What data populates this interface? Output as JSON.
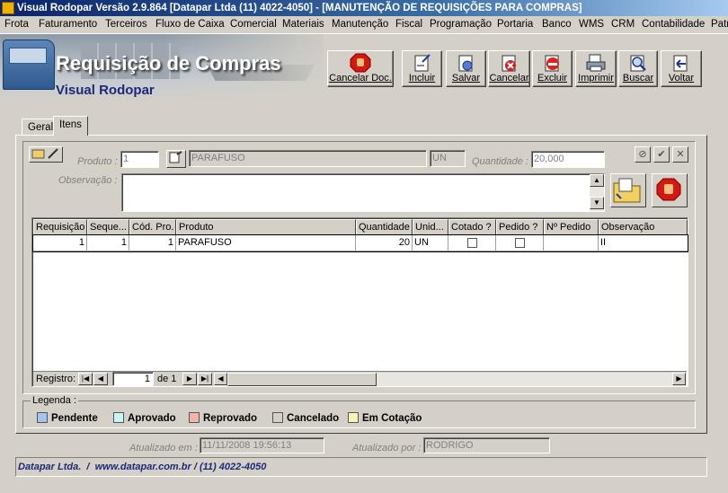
{
  "window": {
    "title": "Visual Rodopar Versão 2.9.864 [Datapar Ltda (11) 4022-4050]  - [MANUTENÇÃO DE REQUISIÇÕES PARA COMPRAS]"
  },
  "menu": [
    "Frota",
    "Faturamento",
    "Terceiros",
    "Fluxo de Caixa",
    "Comercial",
    "Materiais",
    "Manutenção",
    "Fiscal",
    "Programação",
    "Portaria",
    "Banco",
    "WMS",
    "CRM",
    "Contabilidade",
    "Patr"
  ],
  "banner": {
    "title": "Requisição de Compras",
    "subtitle": "Visual Rodopar"
  },
  "toolbar": {
    "cancel_doc": "Cancelar Doc.",
    "incluir": "Incluir",
    "salvar": "Salvar",
    "cancelar": "Cancelar",
    "excluir": "Excluir",
    "imprimir": "Imprimir",
    "buscar": "Buscar",
    "voltar": "Voltar"
  },
  "tabs": {
    "geral": "Geral",
    "itens": "Itens"
  },
  "form": {
    "produto_label": "Produto :",
    "produto_code": "1",
    "produto_name": "PARAFUSO",
    "unit": "UN",
    "quantidade_label": "Quantidade :",
    "quantidade": "20,000",
    "observacao_label": "Observação :",
    "observacao": ""
  },
  "grid": {
    "headers": [
      "Requisição",
      "Seque...",
      "Cód. Pro.",
      "Produto",
      "Quantidade",
      "Unid...",
      "Cotado ?",
      "Pedido ?",
      "Nº Pedido",
      "Observação"
    ],
    "rows": [
      {
        "requisicao": "1",
        "sequencia": "1",
        "cod": "1",
        "produto": "PARAFUSO",
        "quantidade": "20",
        "unid": "UN",
        "cotado": false,
        "pedido": false,
        "num_pedido": "",
        "observacao": "II"
      }
    ]
  },
  "navigator": {
    "label": "Registro:",
    "current": "1",
    "of": "de 1"
  },
  "legend": {
    "title": "Legenda :",
    "items": [
      {
        "label": "Pendente",
        "color": "#a7c4f0"
      },
      {
        "label": "Aprovado",
        "color": "#c8f4f8"
      },
      {
        "label": "Reprovado",
        "color": "#f4b4a8"
      },
      {
        "label": "Cancelado",
        "color": "#d4d0c8"
      },
      {
        "label": "Em Cotação",
        "color": "#f8f4b8"
      }
    ]
  },
  "audit": {
    "atualizado_em_label": "Atualizado em :",
    "atualizado_em": "11/11/2008 19:56:13",
    "atualizado_por_label": "Atualizado por :",
    "atualizado_por": "RODRIGO"
  },
  "footer": {
    "company": "Datapar Ltda.",
    "site": "www.datapar.com.br",
    "phone": "(11) 4022-4050"
  }
}
